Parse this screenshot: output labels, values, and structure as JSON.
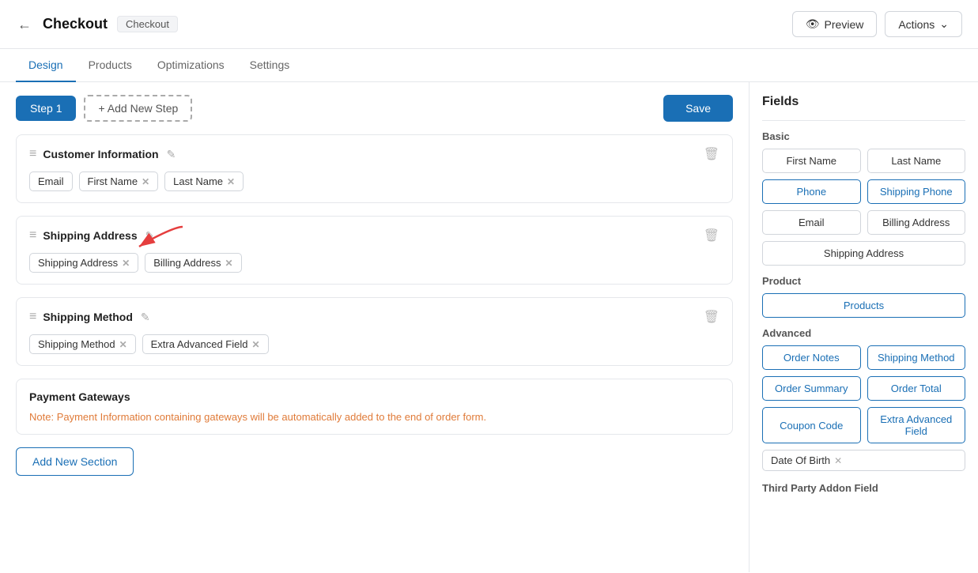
{
  "header": {
    "back_icon": "←",
    "title": "Checkout",
    "badge": "Checkout",
    "preview_label": "Preview",
    "actions_label": "Actions",
    "actions_chevron": "∨"
  },
  "tabs": [
    {
      "label": "Design",
      "active": true
    },
    {
      "label": "Products",
      "active": false
    },
    {
      "label": "Optimizations",
      "active": false
    },
    {
      "label": "Settings",
      "active": false
    }
  ],
  "toolbar": {
    "step_label": "Step 1",
    "add_step_label": "+ Add New Step",
    "save_label": "Save"
  },
  "sections": [
    {
      "id": "customer-information",
      "title": "Customer Information",
      "fields": [
        {
          "label": "Email",
          "removable": false
        },
        {
          "label": "First Name",
          "removable": true
        },
        {
          "label": "Last Name",
          "removable": true
        }
      ]
    },
    {
      "id": "shipping-address",
      "title": "Shipping Address",
      "fields": [
        {
          "label": "Shipping Address",
          "removable": true
        },
        {
          "label": "Billing Address",
          "removable": true
        }
      ]
    },
    {
      "id": "shipping-method",
      "title": "Shipping Method",
      "fields": [
        {
          "label": "Shipping Method",
          "removable": true
        },
        {
          "label": "Extra Advanced Field",
          "removable": true
        }
      ]
    }
  ],
  "payment": {
    "title": "Payment Gateways",
    "note_prefix": "Note: ",
    "note_colored": "Payment Information containing gateways will be automatically added to the end of order form.",
    "note_suffix": ""
  },
  "add_section_label": "Add New Section",
  "fields_panel": {
    "title": "Fields",
    "basic_label": "Basic",
    "basic_fields": [
      {
        "label": "First Name",
        "col": 1,
        "highlighted": false
      },
      {
        "label": "Last Name",
        "col": 2,
        "highlighted": false
      },
      {
        "label": "Phone",
        "col": 1,
        "highlighted": true
      },
      {
        "label": "Shipping Phone",
        "col": 2,
        "highlighted": true
      },
      {
        "label": "Email",
        "col": 1,
        "highlighted": false
      },
      {
        "label": "Billing Address",
        "col": 2,
        "highlighted": false
      },
      {
        "label": "Shipping Address",
        "col": "full",
        "highlighted": false
      }
    ],
    "product_label": "Product",
    "product_fields": [
      {
        "label": "Products",
        "col": "full",
        "highlighted": true
      }
    ],
    "advanced_label": "Advanced",
    "advanced_fields": [
      {
        "label": "Order Notes",
        "col": 1,
        "highlighted": true
      },
      {
        "label": "Shipping Method",
        "col": 2,
        "highlighted": true
      },
      {
        "label": "Order Summary",
        "col": 1,
        "highlighted": true
      },
      {
        "label": "Order Total",
        "col": 2,
        "highlighted": true
      },
      {
        "label": "Coupon Code",
        "col": 1,
        "highlighted": true
      },
      {
        "label": "Extra Advanced Field",
        "col": 2,
        "highlighted": true
      }
    ],
    "date_of_birth": "Date Of Birth",
    "third_party_label": "Third Party Addon Field"
  }
}
